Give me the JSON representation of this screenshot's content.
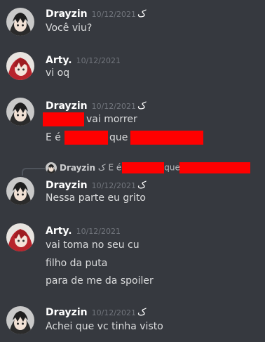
{
  "users": {
    "drayzin": {
      "name": "Drayzin",
      "tag": "ک",
      "avatar": "dark-haired-anime-avatar"
    },
    "arty": {
      "name": "Arty.",
      "avatar": "red-haired-anime-avatar"
    }
  },
  "messages": [
    {
      "author": "Drayzin",
      "tag": "ک",
      "timestamp": "10/12/2021",
      "lines": [
        "Você viu?"
      ]
    },
    {
      "author": "Arty.",
      "timestamp": "10/12/2021",
      "lines": [
        "vi oq"
      ]
    },
    {
      "author": "Drayzin",
      "tag": "ک",
      "timestamp": "10/12/2021",
      "lines": [
        "vai morrer",
        "E é o",
        "que s"
      ]
    },
    {
      "author": "Drayzin",
      "tag": "ک",
      "timestamp": "10/12/2021",
      "lines": [
        "Nessa parte eu grito"
      ]
    },
    {
      "author": "Arty.",
      "timestamp": "10/12/2021",
      "lines": [
        "vai toma no seu cu",
        "filho da puta",
        "para de me da spoiler"
      ]
    },
    {
      "author": "Drayzin",
      "tag": "ک",
      "timestamp": "10/12/2021",
      "lines": [
        "Achei que vc tinha visto"
      ]
    }
  ],
  "reply": {
    "author": "Drayzin",
    "tag": "ک",
    "text_a": "E é",
    "text_b": "que"
  },
  "colors": {
    "background": "#36393f",
    "redaction": "#ff0000",
    "timestamp": "#72767d",
    "text": "#dcddde"
  }
}
